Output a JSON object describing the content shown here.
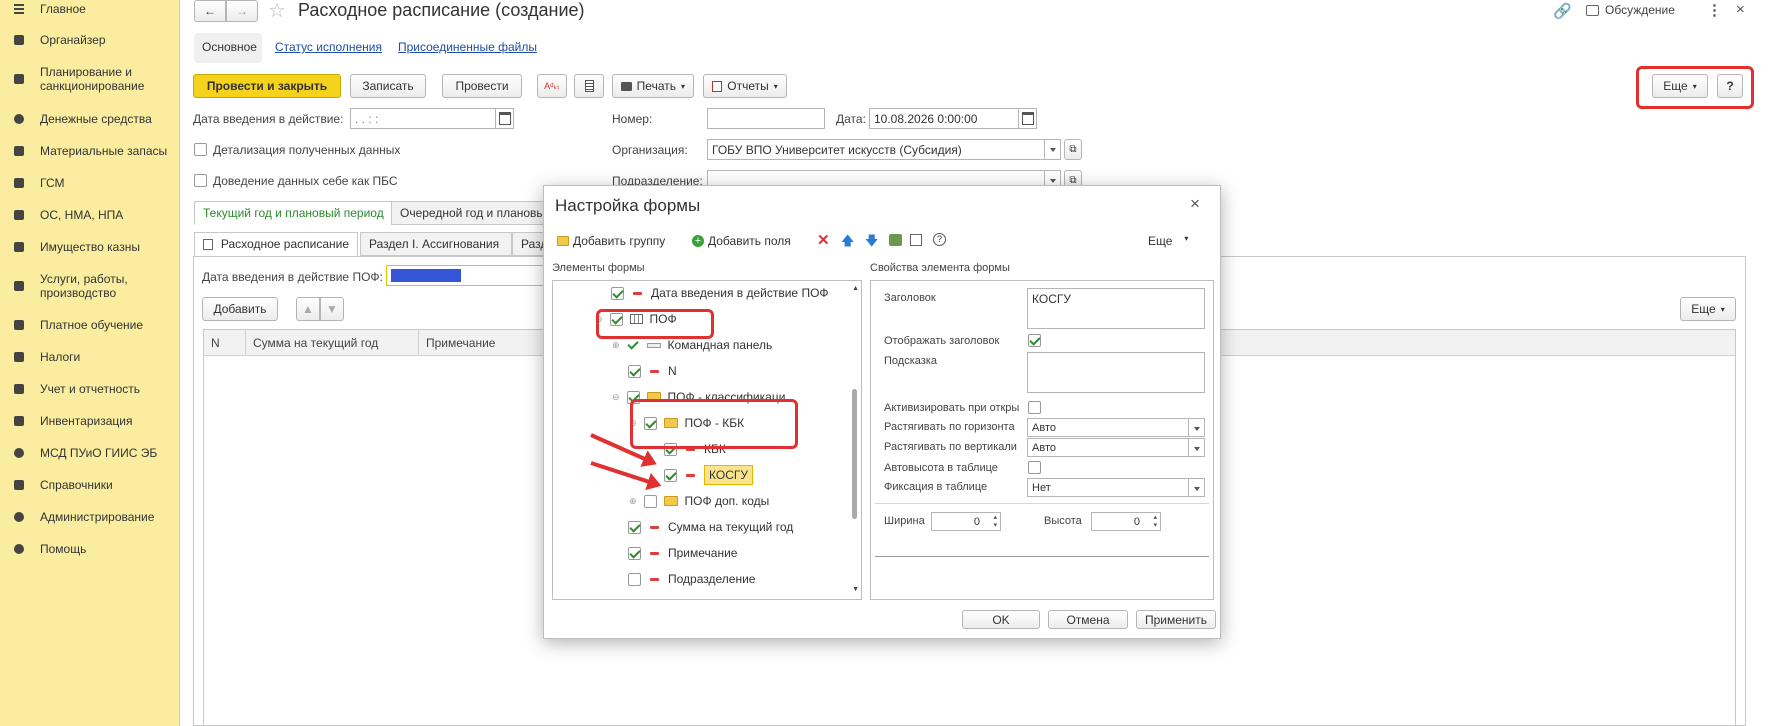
{
  "sidebar": {
    "items": [
      {
        "label": "Главное",
        "icon": "menu-icon"
      },
      {
        "label": "Органайзер",
        "icon": "notepad-icon"
      },
      {
        "label": "Планирование и санкционирование",
        "icon": "chart-icon"
      },
      {
        "label": "Денежные средства",
        "icon": "coin-icon"
      },
      {
        "label": "Материальные запасы",
        "icon": "grid-icon"
      },
      {
        "label": "ГСМ",
        "icon": "fuel-icon"
      },
      {
        "label": "ОС, НМА, НПА",
        "icon": "truck-icon"
      },
      {
        "label": "Имущество казны",
        "icon": "bank-icon"
      },
      {
        "label": "Услуги, работы, производство",
        "icon": "tools-icon"
      },
      {
        "label": "Платное обучение",
        "icon": "graduation-icon"
      },
      {
        "label": "Налоги",
        "icon": "tax-icon"
      },
      {
        "label": "Учет и отчетность",
        "icon": "report-icon"
      },
      {
        "label": "Инвентаризация",
        "icon": "inventory-icon"
      },
      {
        "label": "МСД ПУиО ГИИС ЭБ",
        "icon": "globe-icon"
      },
      {
        "label": "Справочники",
        "icon": "books-icon"
      },
      {
        "label": "Администрирование",
        "icon": "gear-icon"
      },
      {
        "label": "Помощь",
        "icon": "help-icon"
      }
    ]
  },
  "header": {
    "title": "Расходное расписание (создание)",
    "discussion": "Обсуждение"
  },
  "doc_tabs": [
    "Основное",
    "Статус исполнения",
    "Присоединенные файлы"
  ],
  "toolbar": {
    "post_close": "Провести и закрыть",
    "save": "Записать",
    "post": "Провести",
    "print": "Печать",
    "reports": "Отчеты",
    "more": "Еще",
    "help": "?"
  },
  "form": {
    "date_effective_label": "Дата введения в действие:",
    "date_effective_value": " .  .       :  :",
    "number_label": "Номер:",
    "number_value": "",
    "date_label": "Дата:",
    "date_value": "10.08.2026  0:00:00",
    "detail_label": "Детализация полученных данных",
    "pbs_label": "Доведение данных себе как ПБС",
    "org_label": "Организация:",
    "org_value": "ГОБУ ВПО Университет искусств (Субсидия)",
    "dept_label": "Подразделение:",
    "dept_value": ""
  },
  "period_tabs": [
    "Текущий год и плановый период",
    "Очередной год и плановый"
  ],
  "section_tabs": [
    "Расходное расписание",
    "Раздел I. Ассигнования",
    "Разд"
  ],
  "section": {
    "pof_date_label": "Дата введения в действие ПОФ:",
    "add": "Добавить",
    "more": "Еще"
  },
  "table": {
    "columns": [
      "N",
      "Сумма на текущий год",
      "Примечание"
    ]
  },
  "modal": {
    "title": "Настройка формы",
    "add_group": "Добавить группу",
    "add_fields": "Добавить поля",
    "more": "Еще",
    "elements_header": "Элементы формы",
    "properties_header": "Свойства элемента формы",
    "tree": [
      {
        "label": "Дата введения в действие ПОФ",
        "checked": true
      },
      {
        "label": "ПОФ",
        "checked": true
      },
      {
        "label": "Командная панель",
        "checked": true
      },
      {
        "label": "N",
        "checked": true
      },
      {
        "label": "ПОФ - классификаци",
        "checked": true
      },
      {
        "label": "ПОФ - КБК",
        "checked": true
      },
      {
        "label": "КБК",
        "checked": true
      },
      {
        "label": "КОСГУ",
        "checked": true
      },
      {
        "label": "ПОФ доп. коды",
        "checked": false
      },
      {
        "label": "Сумма на текущий год",
        "checked": true
      },
      {
        "label": "Примечание",
        "checked": true
      },
      {
        "label": "Подразделение",
        "checked": false
      }
    ],
    "props": {
      "caption_label": "Заголовок",
      "caption_value": "КОСГУ",
      "show_caption_label": "Отображать заголовок",
      "hint_label": "Подсказка",
      "activate_label": "Активизировать при откры",
      "stretch_h_label": "Растягивать по горизонта",
      "stretch_h_value": "Авто",
      "stretch_v_label": "Растягивать по вертикали",
      "stretch_v_value": "Авто",
      "autoheight_label": "Автовысота в таблице",
      "fix_label": "Фиксация в таблице",
      "fix_value": "Нет",
      "width_label": "Ширина",
      "width_value": "0",
      "height_label": "Высота",
      "height_value": "0"
    },
    "ok": "OK",
    "cancel": "Отмена",
    "apply": "Применить"
  },
  "colors": {
    "sidebar_bg": "#fbeda0",
    "accent_yellow": "#f5d21b",
    "highlight_red": "#e03030",
    "link_blue": "#1e4fa3"
  }
}
